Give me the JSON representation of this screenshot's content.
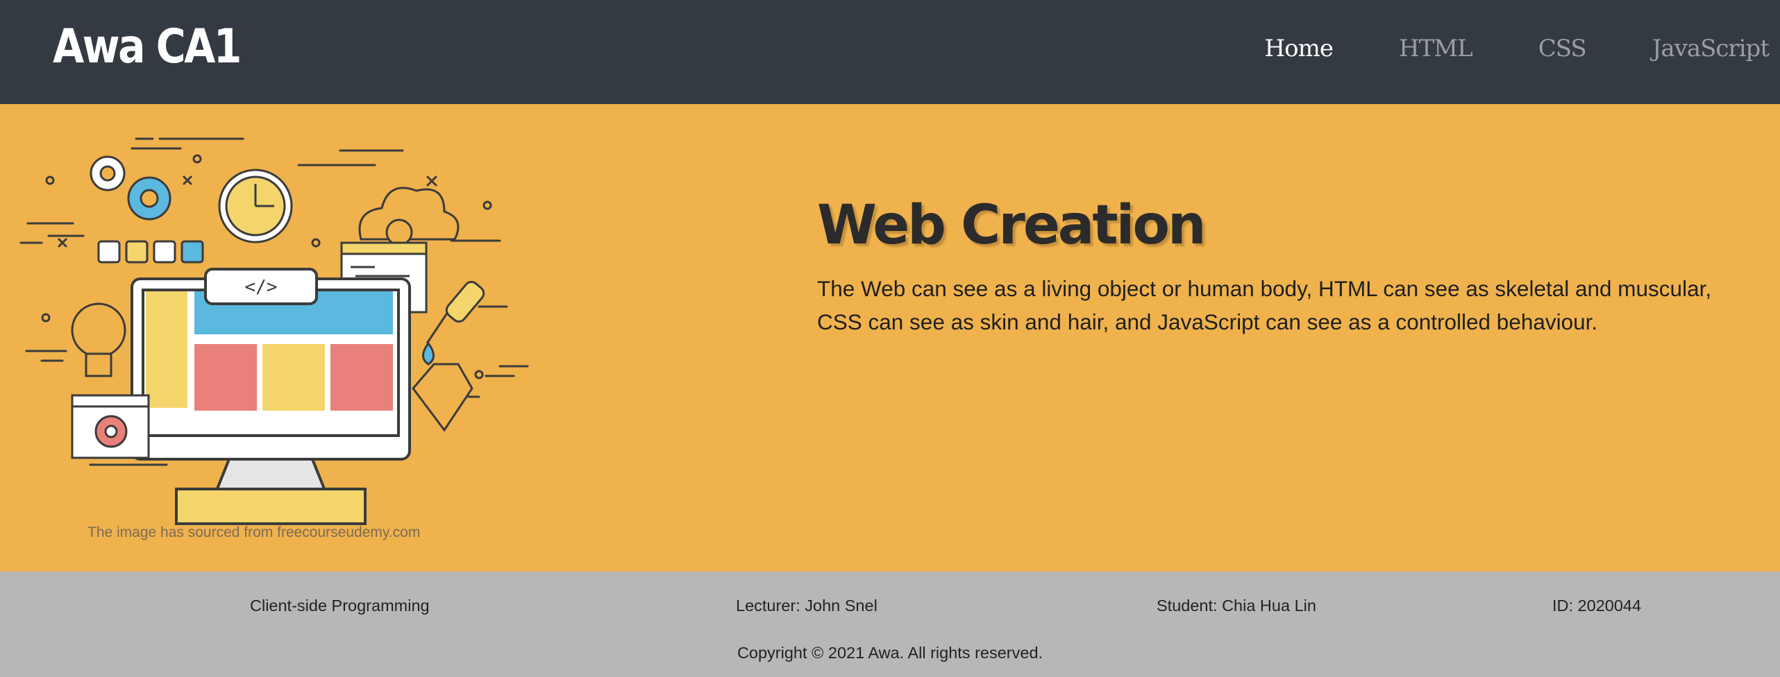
{
  "header": {
    "brand": "Awa CA1",
    "nav": [
      {
        "label": "Home",
        "active": true
      },
      {
        "label": "HTML",
        "active": false
      },
      {
        "label": "CSS",
        "active": false
      },
      {
        "label": "JavaScript",
        "active": false
      }
    ]
  },
  "hero": {
    "title": "Web Creation",
    "text": "The Web can see as a living object or human body, HTML can see as skeletal and muscular, CSS can see as skin and hair, and JavaScript can see as a controlled behaviour.",
    "image_credit": "The image has sourced from freecourseudemy.com",
    "code_tag": "</>"
  },
  "footer": {
    "course": "Client-side Programming",
    "lecturer": "Lecturer: John Snel",
    "student": "Student: Chia Hua Lin",
    "id": "ID: 2020044",
    "copyright": "Copyright © 2021 Awa. All rights reserved."
  },
  "colors": {
    "navbar": "#343a42",
    "hero_bg": "#efb24d",
    "footer_bg": "#b7b7b7",
    "nav_active": "#ffffff",
    "nav_inactive": "#9b9ea2"
  }
}
